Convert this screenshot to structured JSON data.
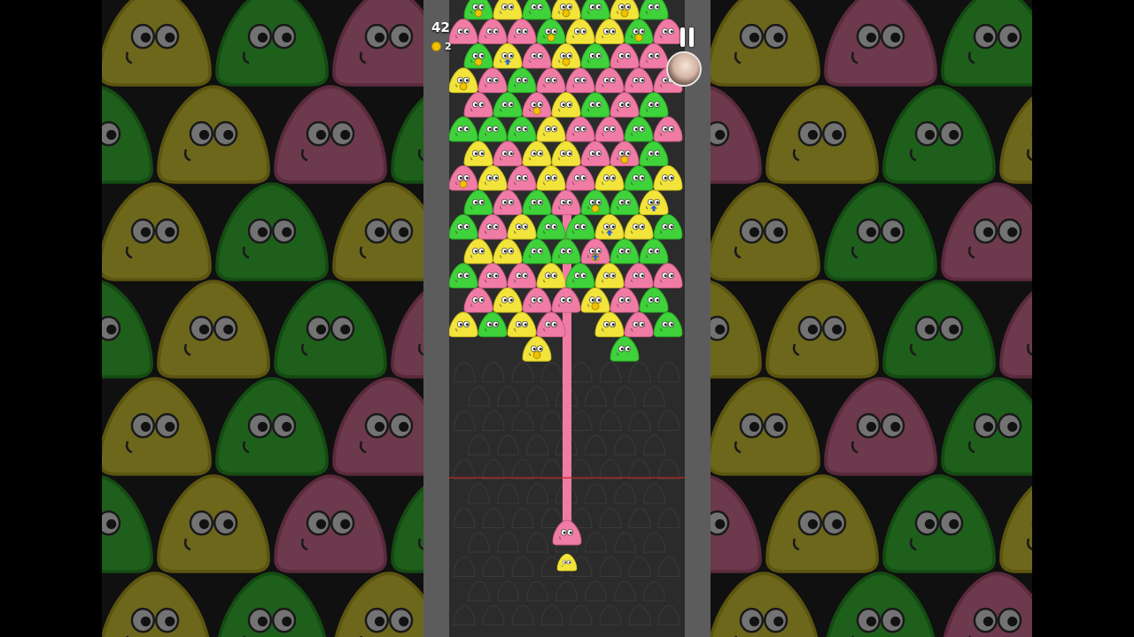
{
  "hud": {
    "score": "42",
    "coins": "2"
  },
  "icons": {
    "pause": "pause-icon",
    "coin": "coin-icon",
    "avatar": "player-avatar"
  },
  "colors": {
    "green": "#3fd23a",
    "pink": "#f07ca6",
    "yellow": "#f2e43a",
    "board": "#2b2b2b",
    "frame": "#5c5c5c",
    "aim_line": "#f07ca6",
    "danger_line": "#c22525"
  },
  "board": {
    "rows": [
      [
        "g",
        "y",
        "g",
        "y",
        "g",
        "y",
        "g"
      ],
      [
        "p",
        "p",
        "p",
        "g",
        "y",
        "y",
        "g",
        "p"
      ],
      [
        "g",
        "y",
        "p",
        "y",
        "g",
        "p",
        "p"
      ],
      [
        "y",
        "p",
        "g",
        "p",
        "p",
        "p",
        "p",
        "p"
      ],
      [
        "p",
        "g",
        "p",
        "y",
        "g",
        "p",
        "g"
      ],
      [
        "g",
        "g",
        "g",
        "y",
        "p",
        "p",
        "g",
        "p"
      ],
      [
        "y",
        "p",
        "y",
        "y",
        "p",
        "p",
        "g"
      ],
      [
        "p",
        "y",
        "p",
        "y",
        "p",
        "y",
        "g",
        "y"
      ],
      [
        "g",
        "p",
        "g",
        "p",
        "g",
        "g",
        "y"
      ],
      [
        "g",
        "p",
        "y",
        "g",
        "g",
        "y",
        "y",
        "g"
      ],
      [
        "y",
        "y",
        "g",
        "g",
        "p",
        "g",
        "g"
      ],
      [
        "g",
        "p",
        "p",
        "y",
        "g",
        "y",
        "p",
        "p"
      ],
      [
        "p",
        "y",
        "p",
        "p",
        "y",
        "p",
        "g"
      ],
      [
        "y",
        "g",
        "y",
        "p",
        "",
        "y",
        "p",
        "g"
      ],
      [
        "",
        "",
        "y",
        "",
        "",
        "g",
        ""
      ]
    ],
    "coin_markers": [
      "0-0",
      "0-3",
      "0-5",
      "2-0",
      "2-3",
      "1-3",
      "1-6",
      "3-0",
      "4-2",
      "6-5",
      "7-0",
      "8-4",
      "10-4",
      "12-4",
      "14-2"
    ],
    "boost_markers": [
      "2-1",
      "8-6",
      "9-5",
      "10-4"
    ]
  },
  "shooter": {
    "current": "p",
    "next": "y"
  }
}
